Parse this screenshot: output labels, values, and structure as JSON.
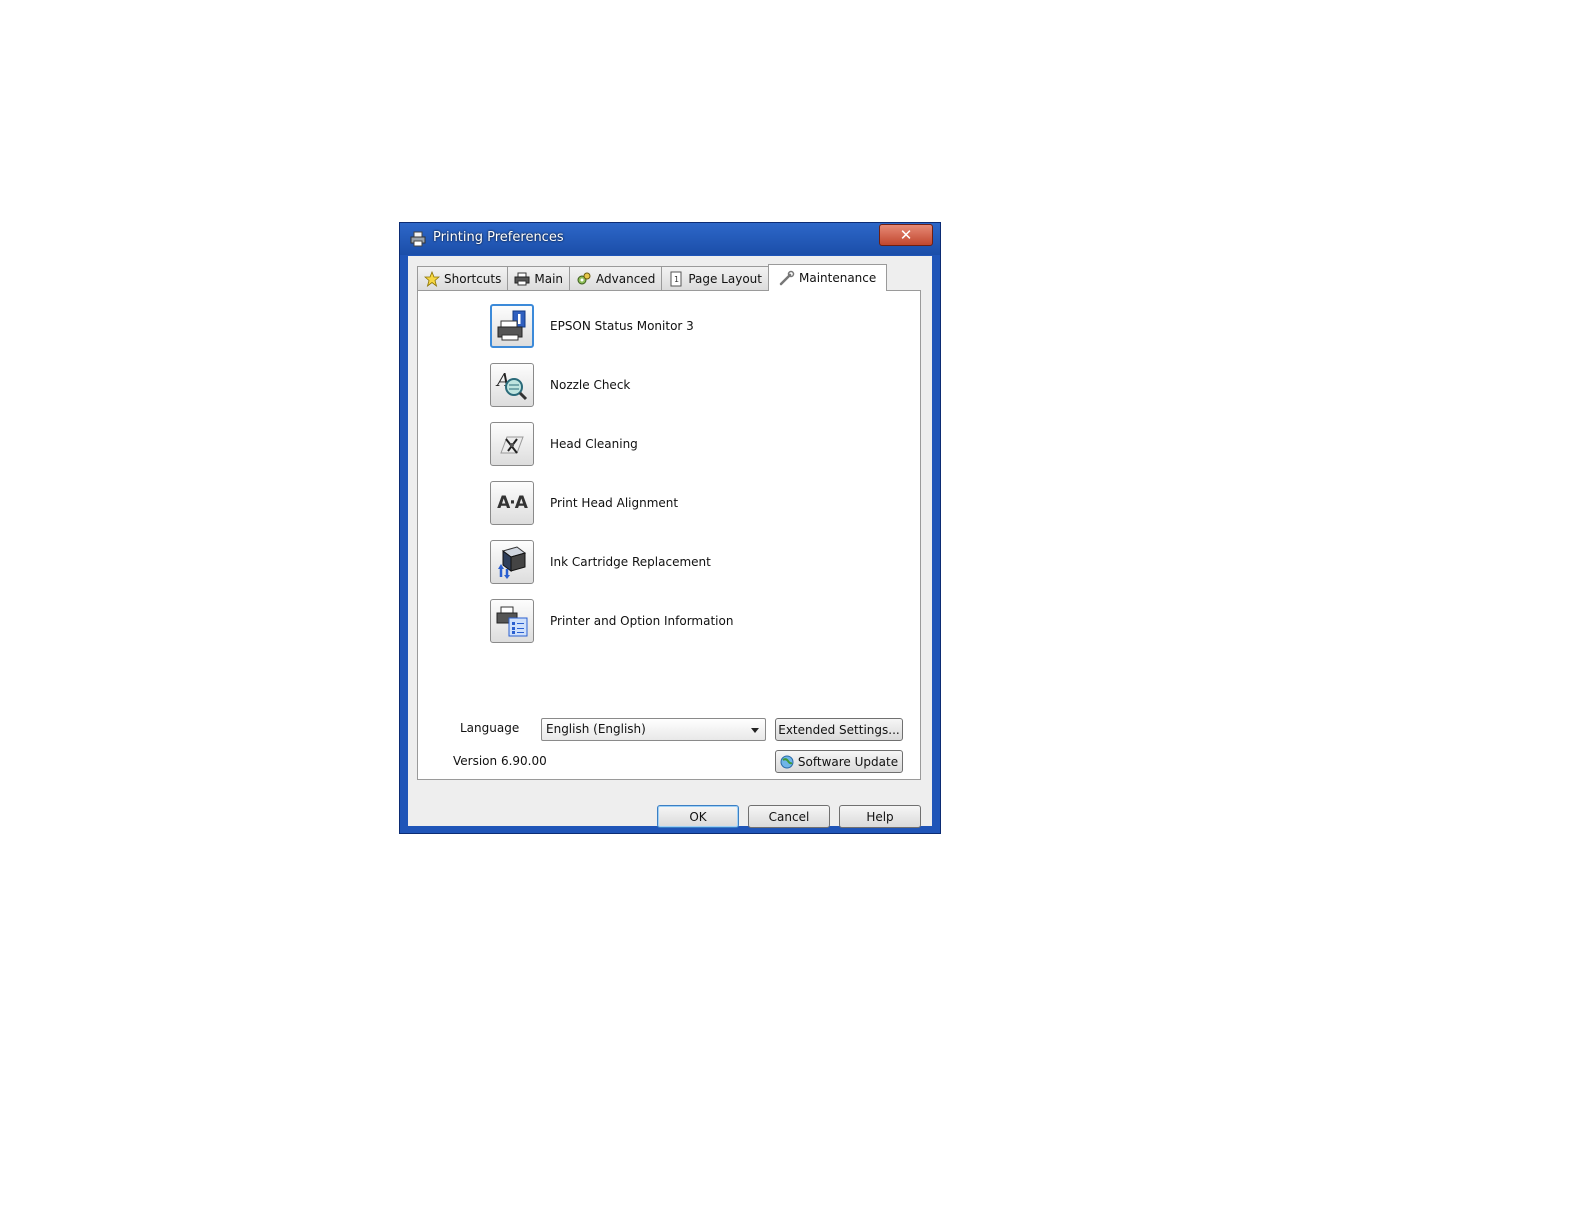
{
  "window": {
    "title": "Printing Preferences",
    "close_glyph": "✕"
  },
  "tabs": [
    {
      "label": "Shortcuts",
      "icon": "star-icon",
      "active": false
    },
    {
      "label": "Main",
      "icon": "printer-icon",
      "active": false
    },
    {
      "label": "Advanced",
      "icon": "gears-icon",
      "active": false
    },
    {
      "label": "Page Layout",
      "icon": "page-icon",
      "active": false
    },
    {
      "label": "Maintenance",
      "icon": "wrench-icon",
      "active": true
    }
  ],
  "tools": [
    {
      "label": "EPSON Status Monitor 3",
      "icon": "status-monitor-icon"
    },
    {
      "label": "Nozzle Check",
      "icon": "nozzle-check-icon"
    },
    {
      "label": "Head Cleaning",
      "icon": "head-cleaning-icon"
    },
    {
      "label": "Print Head Alignment",
      "icon": "head-alignment-icon",
      "glyph": "A·A"
    },
    {
      "label": "Ink Cartridge Replacement",
      "icon": "ink-cartridge-icon"
    },
    {
      "label": "Printer and Option Information",
      "icon": "printer-info-icon"
    }
  ],
  "language": {
    "label": "Language",
    "selected": "English (English)"
  },
  "extended_settings_label": "Extended Settings...",
  "version_text": "Version 6.90.00",
  "software_update_label": "Software Update",
  "footer": {
    "ok_label": "OK",
    "cancel_label": "Cancel",
    "help_label": "Help"
  },
  "colors": {
    "titlebar": "#1f55b8",
    "close_button": "#c1472f",
    "focus_ring": "#3c8ad9"
  }
}
